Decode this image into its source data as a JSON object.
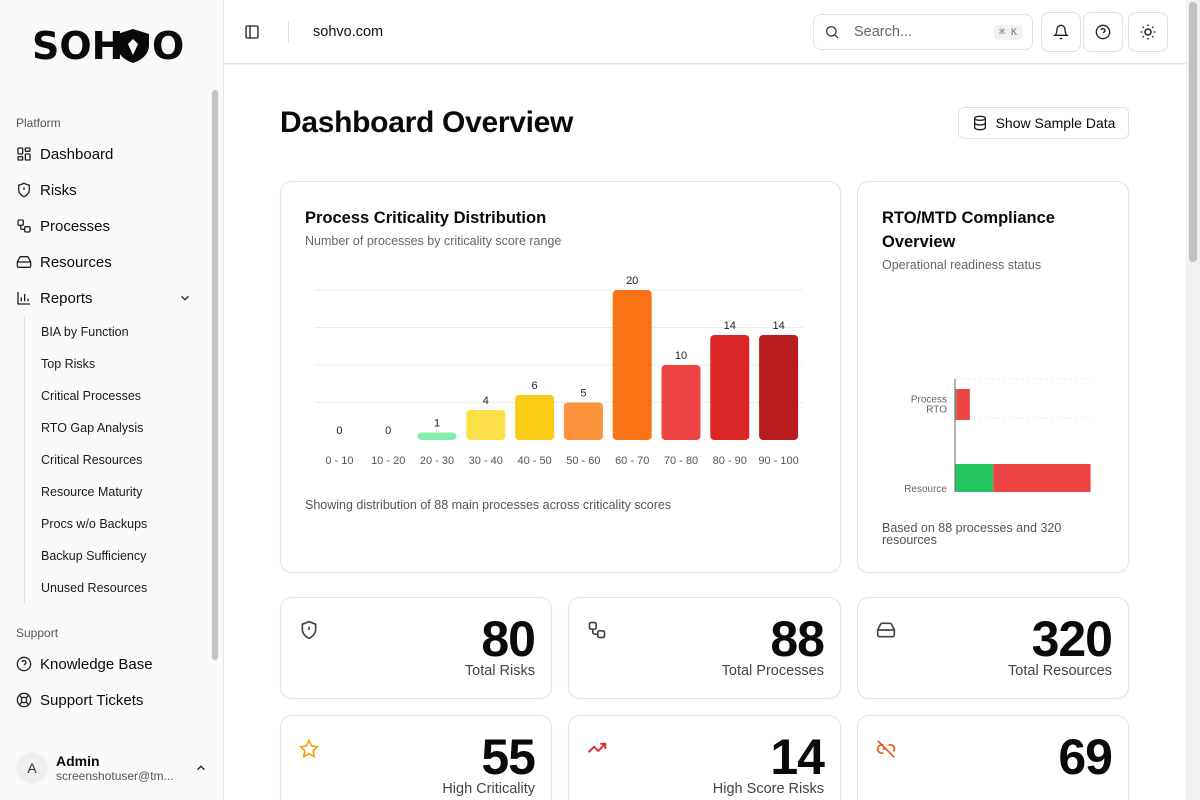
{
  "app": {
    "logo_text": "SOHVO",
    "site_name": "sohvo.com"
  },
  "sidebar": {
    "platform_label": "Platform",
    "items": [
      {
        "label": "Dashboard",
        "icon": "layout-dashboard-icon"
      },
      {
        "label": "Risks",
        "icon": "shield-alert-icon"
      },
      {
        "label": "Processes",
        "icon": "workflow-icon"
      },
      {
        "label": "Resources",
        "icon": "hard-drive-icon"
      },
      {
        "label": "Reports",
        "icon": "bar-chart-icon"
      }
    ],
    "report_items": [
      "BIA by Function",
      "Top Risks",
      "Critical Processes",
      "RTO Gap Analysis",
      "Critical Resources",
      "Resource Maturity",
      "Procs w/o Backups",
      "Backup Sufficiency",
      "Unused Resources"
    ],
    "support_label": "Support",
    "support_items": [
      {
        "label": "Knowledge Base",
        "icon": "help-circle-icon"
      },
      {
        "label": "Support Tickets",
        "icon": "life-buoy-icon"
      }
    ],
    "user": {
      "initial": "A",
      "name": "Admin",
      "email": "screenshotuser@tm..."
    }
  },
  "topbar": {
    "search_placeholder": "Search...",
    "search_shortcut": "⌘ K"
  },
  "main": {
    "title": "Dashboard Overview",
    "sample_button": "Show Sample Data",
    "criticality_card": {
      "title": "Process Criticality Distribution",
      "subtitle": "Number of processes by criticality score range",
      "footer": "Showing distribution of 88 main processes across criticality scores"
    },
    "rto_card": {
      "title": "RTO/MTD Compliance Overview",
      "subtitle": "Operational readiness status",
      "footer": "Based on 88 processes and 320 resources"
    },
    "stats": [
      {
        "value": "80",
        "label": "Total Risks",
        "icon": "shield-alert-icon"
      },
      {
        "value": "88",
        "label": "Total Processes",
        "icon": "workflow-icon"
      },
      {
        "value": "320",
        "label": "Total Resources",
        "icon": "hard-drive-icon"
      },
      {
        "value": "55",
        "label": "High Criticality",
        "icon": "star-icon"
      },
      {
        "value": "14",
        "label": "High Score Risks",
        "icon": "trending-up-icon"
      },
      {
        "value": "69",
        "label": "",
        "icon": "unlink-icon"
      }
    ]
  },
  "chart_data": [
    {
      "type": "bar",
      "categories": [
        "0 - 10",
        "10 - 20",
        "20 - 30",
        "30 - 40",
        "40 - 50",
        "50 - 60",
        "60 - 70",
        "70 - 80",
        "80 - 90",
        "90 - 100"
      ],
      "values": [
        0,
        0,
        1,
        4,
        6,
        5,
        20,
        10,
        14,
        14
      ],
      "colors": [
        "#86efac",
        "#86efac",
        "#86efac",
        "#fde047",
        "#facc15",
        "#fb923c",
        "#f97316",
        "#ef4444",
        "#dc2626",
        "#b91c1c"
      ],
      "ylim": [
        0,
        20
      ],
      "grid": true
    },
    {
      "type": "bar",
      "orientation": "horizontal",
      "stacked": true,
      "categories": [
        "Process RTO",
        "Resource RTO"
      ],
      "series": [
        {
          "values": [
            3,
            90
          ],
          "color": "#22c55e"
        },
        {
          "values": [
            32,
            229
          ],
          "color": "#ef4444"
        }
      ],
      "xticks": [
        0,
        80,
        160,
        240,
        320
      ],
      "xlim": [
        0,
        320
      ],
      "grid": true
    }
  ]
}
